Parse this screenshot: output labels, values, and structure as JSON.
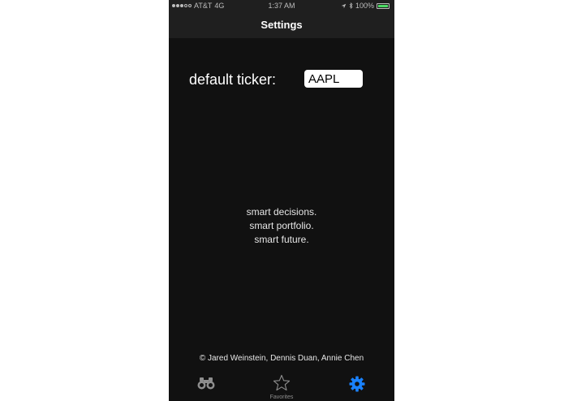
{
  "status_bar": {
    "carrier": "AT&T",
    "network": "4G",
    "time": "1:37 AM",
    "battery": "100%",
    "battery_level": 1.0,
    "battery_color": "#4cd964"
  },
  "nav": {
    "title": "Settings"
  },
  "settings": {
    "ticker_label": "default ticker:",
    "ticker_value": "AAPL"
  },
  "tagline": {
    "line1": "smart decisions.",
    "line2": "smart portfolio.",
    "line3": "smart future."
  },
  "credits": "© Jared Weinstein, Dennis Duan, Annie Chen",
  "tab_bar": {
    "tabs": [
      {
        "icon": "binoculars-icon",
        "label": "",
        "selected": false
      },
      {
        "icon": "star-icon",
        "label": "Favorites",
        "selected": false
      },
      {
        "icon": "gear-icon",
        "label": "",
        "selected": true
      }
    ],
    "accent_color": "#1a82ff",
    "inactive_color": "#8e8e8e"
  }
}
